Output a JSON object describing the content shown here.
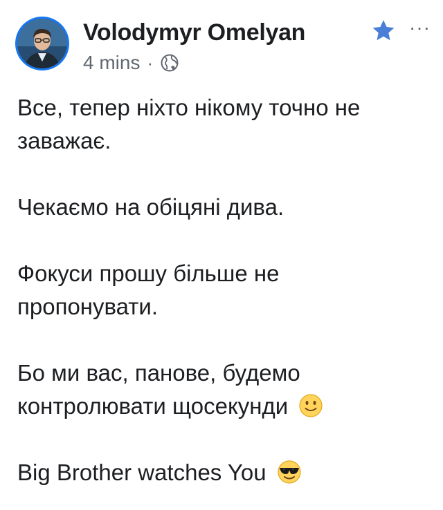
{
  "post": {
    "author": "Volodymyr Omelyan",
    "timestamp": "4 mins",
    "separator": "·",
    "privacy_icon": "globe-icon",
    "favorite_icon": "star-icon",
    "more_label": "···",
    "colors": {
      "accent": "#1877f2",
      "text": "#1c1e21",
      "meta": "#606770"
    }
  },
  "body": {
    "p1_line1": "Все, тепер ніхто нікому точно не",
    "p1_line2": "заважає.",
    "p2_line1": "Чекаємо на обіцяні дива.",
    "p3_line1": "Фокуси прошу більше не",
    "p3_line2": "пропонувати.",
    "p4_line1": "Бо ми вас, панове, будемо",
    "p4_line2": "контролювати щосекунди",
    "p4_emoji": "slightly-smiling-face-emoji",
    "p5_line1": "Big Brother watches You",
    "p5_emoji": "sunglasses-face-emoji"
  }
}
